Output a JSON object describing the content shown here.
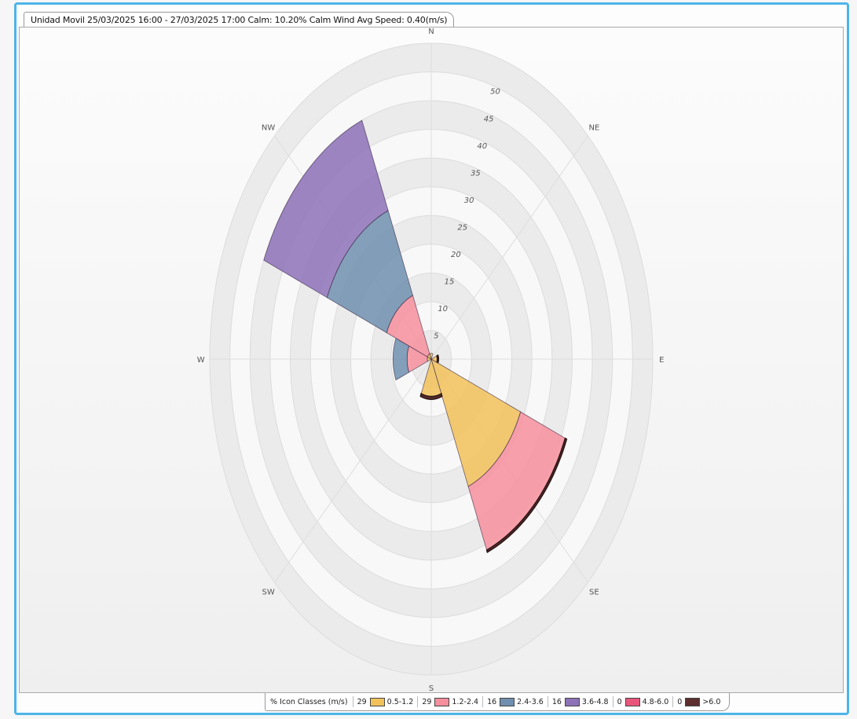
{
  "window": {
    "tab_title": "Unidad Movil 25/03/2025 16:00 - 27/03/2025 17:00 Calm: 10.20%  Calm Wind Avg Speed: 0.40(m/s)"
  },
  "chart_data": {
    "type": "windrose",
    "directions": [
      "N",
      "NE",
      "E",
      "SE",
      "S",
      "SW",
      "W",
      "NW"
    ],
    "radial_ticks": [
      5,
      10,
      15,
      20,
      25,
      30,
      35,
      40,
      45,
      50
    ],
    "rmax": 55,
    "grid": true,
    "classes": [
      {
        "label": "0.5-1.2",
        "pct": "29",
        "color": "#f2c25a"
      },
      {
        "label": "1.2-2.4",
        "pct": "29",
        "color": "#f78f9c"
      },
      {
        "label": "2.4-3.6",
        "pct": "16",
        "color": "#6f8fae"
      },
      {
        "label": "3.6-4.8",
        "pct": "16",
        "color": "#8d72b7"
      },
      {
        "label": "4.8-6.0",
        "pct": "0",
        "color": "#e8567c"
      },
      {
        "label": ">6.0",
        "pct": "0",
        "color": "#5c2e2e"
      }
    ],
    "sectors": [
      {
        "direction": "N",
        "bins": [
          1,
          0,
          0,
          0,
          0,
          0
        ]
      },
      {
        "direction": "NE",
        "bins": [
          0,
          0,
          0,
          0,
          0,
          0
        ]
      },
      {
        "direction": "E",
        "bins": [
          1.5,
          0,
          0,
          0,
          0,
          0.3
        ]
      },
      {
        "direction": "SE",
        "bins": [
          24,
          12,
          0,
          0,
          0,
          0.4
        ]
      },
      {
        "direction": "S",
        "bins": [
          6.5,
          0,
          0,
          0,
          0,
          0.5
        ]
      },
      {
        "direction": "SW",
        "bins": [
          0,
          0,
          0,
          0,
          0,
          0
        ]
      },
      {
        "direction": "W",
        "bins": [
          1,
          5,
          3.5,
          0,
          0,
          0
        ]
      },
      {
        "direction": "NW",
        "bins": [
          1,
          11,
          16,
          17,
          0,
          0
        ]
      }
    ]
  },
  "legend": {
    "title": "% Icon  Classes (m/s)"
  }
}
